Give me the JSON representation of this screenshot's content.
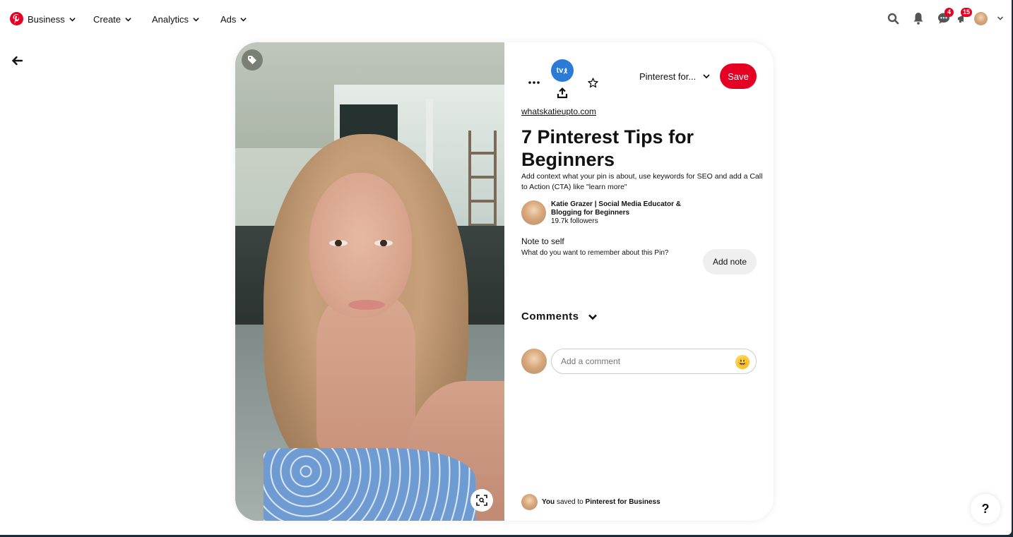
{
  "topnav": {
    "logo_icon": "pinterest-logo",
    "items": [
      {
        "label": "Business",
        "icon": "chevron-down-icon"
      },
      {
        "label": "Create",
        "icon": "chevron-down-icon"
      },
      {
        "label": "Analytics",
        "icon": "chevron-down-icon"
      },
      {
        "label": "Ads",
        "icon": "chevron-down-icon"
      }
    ],
    "right_icons": [
      {
        "name": "search-icon"
      },
      {
        "name": "bell-icon"
      },
      {
        "name": "messages-icon",
        "badge": "4"
      },
      {
        "name": "updates-icon",
        "badge": "15"
      },
      {
        "name": "profile-avatar"
      },
      {
        "name": "accounts-chevron-icon"
      }
    ],
    "badge_color": "#e60023"
  },
  "back_icon": "arrow-left-icon",
  "pin": {
    "image_overlays": {
      "tag_icon": "tag-icon",
      "lens_icon": "visual-search-icon"
    },
    "toolbar": {
      "more_icon": "ellipsis-icon",
      "extension_label": "tv",
      "share_icon": "share-upload-icon",
      "favorite_icon": "star-outline-icon",
      "board_select": "Pinterest for...",
      "save_label": "Save",
      "save_color": "#e60023"
    },
    "source_link": "whatskatieupto.com",
    "title": "7 Pinterest Tips for Beginners",
    "description": "Add context what your pin is about, use keywords for SEO and add a Call to Action (CTA) like \"learn more\"",
    "creator": {
      "name": "Katie Grazer | Social Media Educator & Blogging for Beginners",
      "followers": "19.7k followers"
    },
    "note": {
      "title": "Note to self",
      "subtitle": "What do you want to remember about this Pin?",
      "button": "Add note"
    },
    "comments": {
      "heading": "Comments",
      "input_placeholder": "Add a comment",
      "emoji_icon": "😃"
    },
    "saved": {
      "you": "You",
      "text": "saved to",
      "board": "Pinterest for Business"
    }
  },
  "help_label": "?"
}
